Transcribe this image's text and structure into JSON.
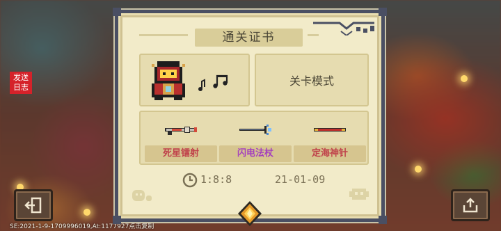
{
  "side": {
    "send_log": "发送\n日志",
    "exit_icon": "exit-door-icon",
    "share_icon": "share-upload-icon"
  },
  "debug_text": "SE:2021-1-9-1709996019,At:1177927点击复制",
  "certificate": {
    "title": "通关证书",
    "mode": "关卡模式",
    "hero_icon": "red-hooded-wizard-sprite",
    "note_icon": "music-note-icon",
    "weapons": [
      {
        "name": "死星镭射",
        "color": "#c0434b",
        "icon": "laser-gun-icon"
      },
      {
        "name": "闪电法杖",
        "color": "#a43fbe",
        "icon": "lightning-staff-icon"
      },
      {
        "name": "定海神针",
        "color": "#c0434b",
        "icon": "golden-staff-icon"
      }
    ],
    "time": "1:8:8",
    "date": "21-01-09"
  },
  "colors": {
    "paper": "#f2ebc9",
    "frame": "#4a4f63",
    "text": "#4b4636"
  }
}
